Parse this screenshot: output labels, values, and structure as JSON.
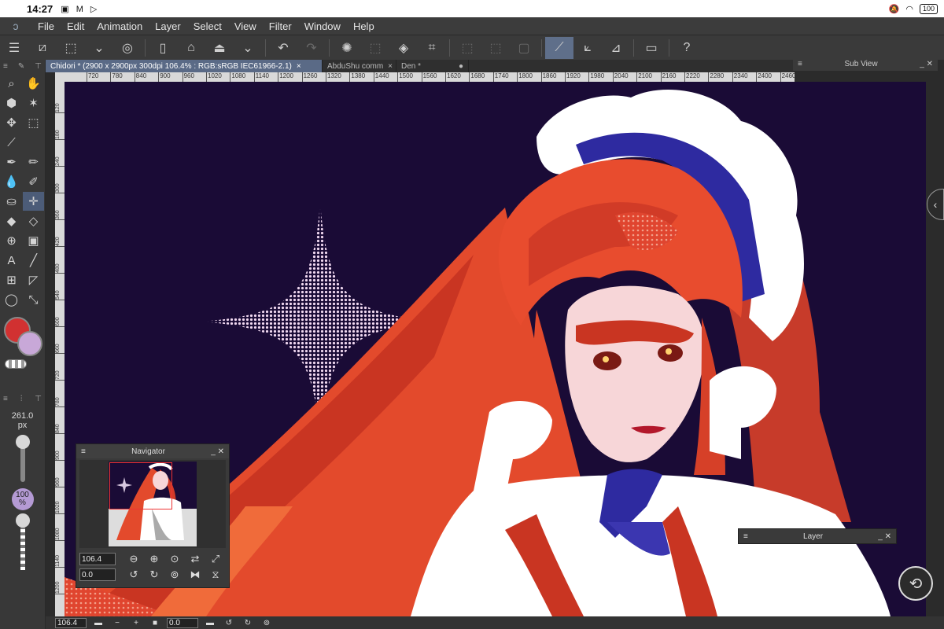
{
  "status_bar": {
    "time": "14:27",
    "notifications": "▣ M ▷",
    "battery": "100"
  },
  "menu": [
    "File",
    "Edit",
    "Animation",
    "Layer",
    "Select",
    "View",
    "Filter",
    "Window",
    "Help"
  ],
  "document_tabs": [
    {
      "label": "Chidori * (2900 x 2900px 300dpi 106.4% : RGB:sRGB IEC61966-2.1)",
      "close": "×"
    },
    {
      "label": "AbduShu comm",
      "close": "×"
    },
    {
      "label": "Den *",
      "close": "●"
    }
  ],
  "ruler_h": [
    "720",
    "780",
    "840",
    "900",
    "960",
    "1020",
    "1080",
    "1140",
    "1200",
    "1260",
    "1320",
    "1380",
    "1440",
    "1500",
    "1560",
    "1620",
    "1680",
    "1740",
    "1800",
    "1860",
    "1920",
    "1980",
    "2040",
    "2100",
    "2160",
    "2220",
    "2280",
    "2340",
    "2400",
    "2460"
  ],
  "ruler_v": [
    "120",
    "180",
    "240",
    "300",
    "360",
    "420",
    "480",
    "540",
    "600",
    "660",
    "720",
    "780",
    "840",
    "900",
    "960",
    "1020",
    "1080",
    "1140",
    "1200"
  ],
  "sub_view": {
    "title": "Sub View"
  },
  "brush_size": {
    "value": "261.0",
    "unit": "px"
  },
  "opacity": {
    "value": "100",
    "unit": "%"
  },
  "navigator": {
    "title": "Navigator",
    "zoom": "106.4",
    "rotation": "0.0"
  },
  "layer_panel": {
    "title": "Layer"
  },
  "bottom_bar": {
    "zoom": "106.4",
    "rotation": "0.0"
  },
  "colors": {
    "main": "#d13131",
    "sub": "#c8a8d8",
    "canvas_bg": "#1a0b36",
    "accent": "#5f6f8a"
  }
}
